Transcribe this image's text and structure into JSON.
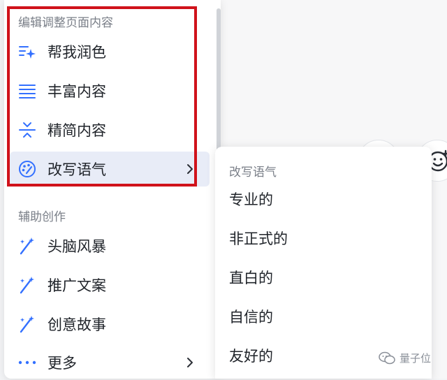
{
  "colors": {
    "accent": "#3370ff",
    "highlight": "#d0121b",
    "active_bg": "#e8ecf7"
  },
  "menu": {
    "section1_title": "编辑调整页面内容",
    "section1_items": [
      {
        "label": "帮我润色",
        "icon": "sparkle-lines-icon"
      },
      {
        "label": "丰富内容",
        "icon": "lines-icon"
      },
      {
        "label": "精简内容",
        "icon": "compress-icon"
      },
      {
        "label": "改写语气",
        "icon": "palette-icon",
        "has_submenu": true,
        "active": true
      }
    ],
    "section2_title": "辅助创作",
    "section2_items": [
      {
        "label": "头脑风暴",
        "icon": "magic-wand-icon"
      },
      {
        "label": "推广文案",
        "icon": "magic-wand-icon"
      },
      {
        "label": "创意故事",
        "icon": "magic-wand-icon"
      },
      {
        "label": "更多",
        "icon": "more-dots-icon",
        "has_submenu": true
      }
    ]
  },
  "submenu": {
    "title": "改写语气",
    "items": [
      "专业的",
      "非正式的",
      "直白的",
      "自信的",
      "友好的"
    ]
  },
  "watermark": {
    "text": "量子位"
  }
}
